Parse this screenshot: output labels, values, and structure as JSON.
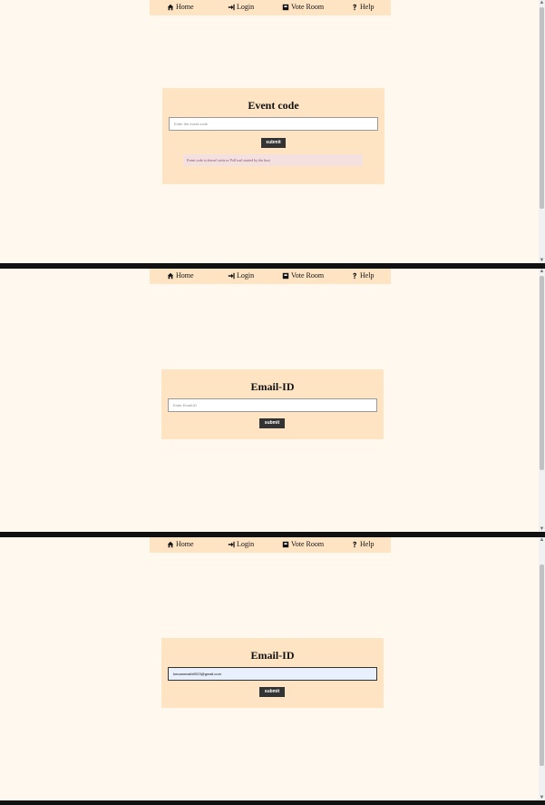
{
  "nav": {
    "home": "Home",
    "login": "Login",
    "vote_room": "Vote Room",
    "help": "Help"
  },
  "screen1": {
    "title": "Event code",
    "input_placeholder": "Enter the event code",
    "submit_label": "submit",
    "error_message": "Event code is doesn't exits or Poll isn't started by the host"
  },
  "screen2": {
    "title": "Email-ID",
    "input_placeholder": "Enter Email-ID",
    "submit_label": "submit"
  },
  "screen3": {
    "title": "Email-ID",
    "input_value": "kmoanmakh0923@gmail.com",
    "submit_label": "submit"
  },
  "icons": {
    "home": "home-icon",
    "login": "sign-in-icon",
    "vote_room": "ballot-box-icon",
    "help": "question-icon"
  },
  "colors": {
    "page_bg": "#fff8ef",
    "card_bg": "#ffe4c4",
    "button_bg": "#333333",
    "error_bg": "#f3e0df",
    "error_text": "#7a4e6b"
  }
}
